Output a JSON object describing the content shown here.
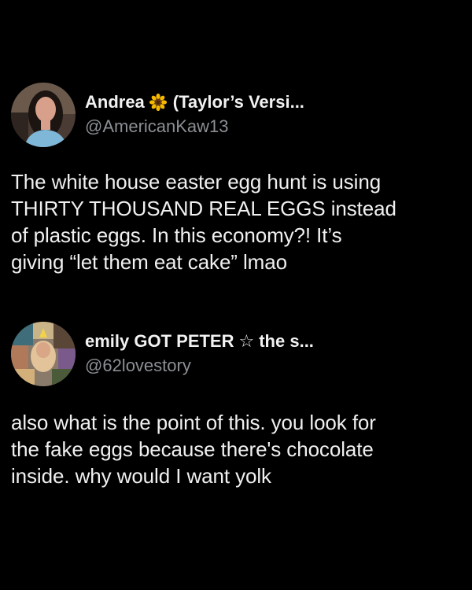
{
  "posts": [
    {
      "display_name": "Andrea",
      "emoji_icon": "sunflower-icon",
      "display_suffix": "(Taylor’s Versi...",
      "handle": "@AmericanKaw13",
      "text_lines": [
        "The white house easter egg hunt is using",
        "THIRTY THOUSAND REAL EGGS instead",
        "of plastic eggs. In this economy?! It’s",
        "giving “let them eat cake” lmao"
      ]
    },
    {
      "display_name": "emily GOT PETER",
      "emoji_icon": "star-outline-icon",
      "star_glyph": "☆",
      "display_suffix": "the s...",
      "handle": "@62lovestory",
      "text_lines": [
        "also what is the point of this. you look for",
        "the fake eggs because there's chocolate",
        "inside. why would I want yolk"
      ]
    }
  ],
  "colors": {
    "background": "#000000",
    "text_primary": "#f0f0f0",
    "text_secondary": "#8b8f94",
    "sunflower_petals": "#f5b800",
    "sunflower_center": "#6b3a12"
  }
}
